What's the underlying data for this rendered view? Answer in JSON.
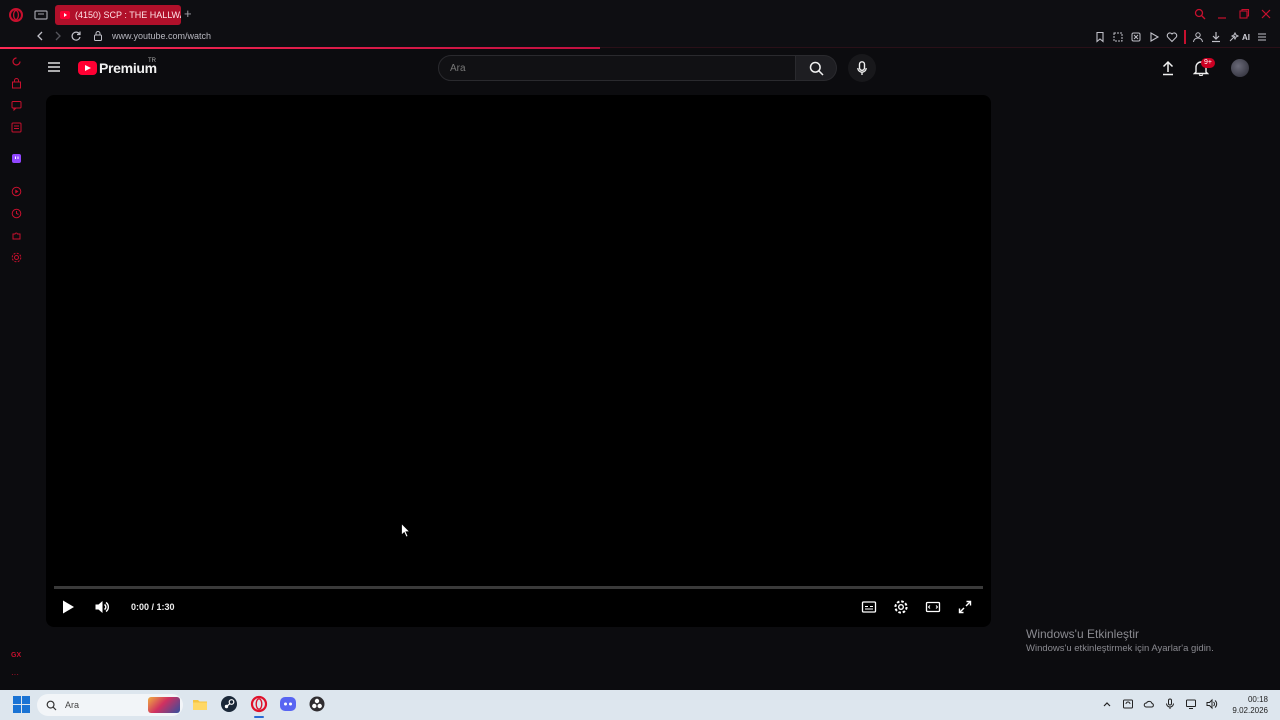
{
  "browser": {
    "tab_title": "(4150) SCP : THE HALLWA",
    "new_tab": "+",
    "url": "www.youtube.com/watch",
    "ai_label": "AI"
  },
  "sidebar": {
    "gx_label": "GX",
    "more_label": "···"
  },
  "youtube": {
    "logo_text": "Premium",
    "region": "TR",
    "search_placeholder": "Ara",
    "notification_badge": "9+"
  },
  "player": {
    "time": "0:00 / 1:30",
    "duration_seconds": 90,
    "position_seconds": 0
  },
  "watermark": {
    "title": "Windows'u Etkinleştir",
    "subtitle": "Windows'u etkinleştirmek için Ayarlar'a gidin."
  },
  "taskbar": {
    "search_label": "Ara",
    "time": "00:18",
    "date": "9.02.2026"
  },
  "colors": {
    "accent": "#ff0033",
    "opera_red": "#b0102a",
    "sidebar_icon": "#c8102e"
  }
}
